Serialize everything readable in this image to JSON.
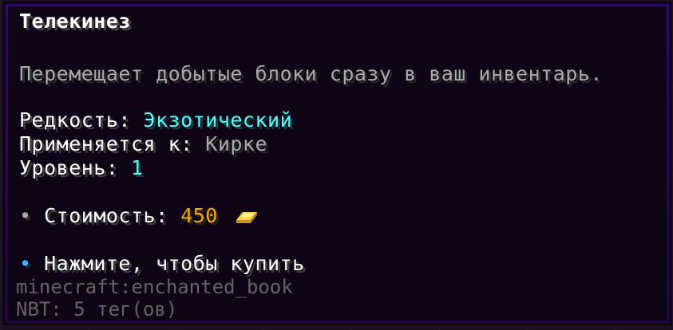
{
  "tooltip": {
    "title": "Телекинез",
    "description": "Перемещает добытые блоки сразу в ваш инвентарь.",
    "rarity_label": "Редкость: ",
    "rarity_value": "Экзотический",
    "applies_label": "Применяется к: ",
    "applies_value": "Кирке",
    "level_label": "Уровень: ",
    "level_value": "1",
    "cost_bullet": "•",
    "cost_label": " Стоимость: ",
    "cost_value": "450",
    "cost_icon": "gold-ingot-icon",
    "buy_bullet": "•",
    "buy_label": " Нажмите, чтобы купить"
  },
  "debug": {
    "item_id": "minecraft:enchanted_book",
    "nbt": "NBT: 5 тег(ов)"
  },
  "colors": {
    "title": "#ffffff",
    "description": "#aaaaaa",
    "rarity": "#55ffff",
    "cost": "#ffaa00",
    "buy_bullet": "#55aaff",
    "tooltip_bg": "#100416",
    "tooltip_border": "#5000ff"
  }
}
